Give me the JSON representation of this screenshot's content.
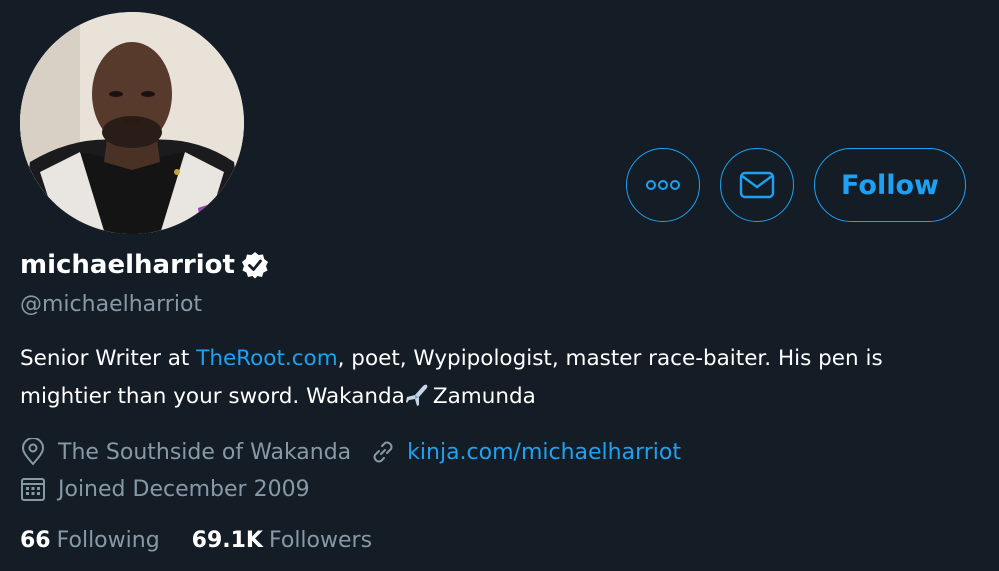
{
  "profile": {
    "display_name": "michaelharriot",
    "handle": "@michaelharriot",
    "bio": {
      "prefix": "Senior Writer at ",
      "link": "TheRoot.com",
      "middle": ", poet, Wypipologist, master race-baiter. His pen is mightier than your sword. Wakanda",
      "emoji": "airplane-emoji",
      "suffix": "Zamunda"
    },
    "location": "The Southside of Wakanda",
    "website": "kinja.com/michaelharriot",
    "joined": "Joined December 2009"
  },
  "actions": {
    "more_icon": "more-icon",
    "message_icon": "mail-icon",
    "follow_label": "Follow"
  },
  "stats": {
    "following_count": "66",
    "following_label": "Following",
    "followers_count": "69.1K",
    "followers_label": "Followers"
  },
  "colors": {
    "background": "#141d26",
    "accent": "#1da1f2",
    "secondary_text": "#8899a6"
  }
}
